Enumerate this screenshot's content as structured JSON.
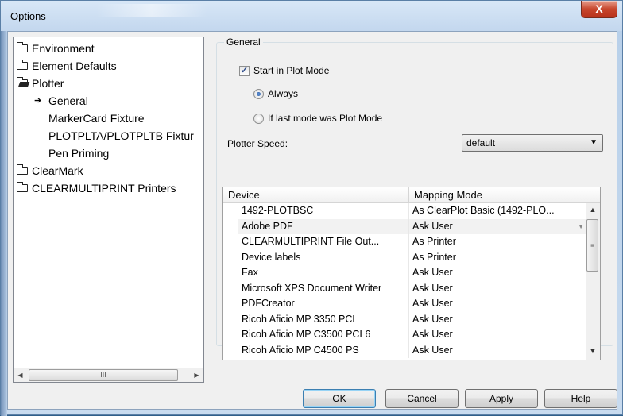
{
  "window": {
    "title": "Options",
    "close_glyph": "X"
  },
  "tree": {
    "items": [
      {
        "label": "Environment",
        "icon": "folder-icon",
        "level": 0
      },
      {
        "label": "Element Defaults",
        "icon": "folder-icon",
        "level": 0
      },
      {
        "label": "Plotter",
        "icon": "folder-open-icon",
        "level": 0
      },
      {
        "label": "General",
        "icon": "arrow-right-icon",
        "level": 1,
        "selected": true
      },
      {
        "label": "MarkerCard Fixture",
        "level": 1
      },
      {
        "label": "PLOTPLTA/PLOTPLTB Fixtur",
        "level": 1
      },
      {
        "label": "Pen Priming",
        "level": 1
      },
      {
        "label": "ClearMark",
        "icon": "folder-icon",
        "level": 0
      },
      {
        "label": "CLEARMULTIPRINT Printers",
        "icon": "folder-icon",
        "level": 0
      }
    ],
    "scroll_thumb_grip": "III"
  },
  "general": {
    "group_title": "General",
    "start_in_plot_mode": {
      "label": "Start in Plot Mode",
      "checked": true
    },
    "radio_always": {
      "label": "Always",
      "checked": true
    },
    "radio_last_mode": {
      "label": "If last mode was Plot Mode",
      "checked": false
    },
    "plotter_speed_label": "Plotter Speed:",
    "plotter_speed_value": "default"
  },
  "grid": {
    "columns": [
      "Device",
      "Mapping Mode"
    ],
    "rows": [
      {
        "device": "1492-PLOTBSC",
        "mapping": "As ClearPlot Basic (1492-PLO..."
      },
      {
        "device": "Adobe PDF",
        "mapping": "Ask User"
      },
      {
        "device": "CLEARMULTIPRINT File Out...",
        "mapping": "As Printer"
      },
      {
        "device": "Device labels",
        "mapping": "As Printer"
      },
      {
        "device": "Fax",
        "mapping": "Ask User"
      },
      {
        "device": "Microsoft XPS Document Writer",
        "mapping": "Ask User"
      },
      {
        "device": "PDFCreator",
        "mapping": "Ask User"
      },
      {
        "device": "Ricoh Aficio MP 3350 PCL",
        "mapping": "Ask User"
      },
      {
        "device": "Ricoh Aficio MP C3500 PCL6",
        "mapping": "Ask User"
      },
      {
        "device": "Ricoh Aficio MP C4500 PS",
        "mapping": "Ask User"
      }
    ]
  },
  "buttons": {
    "ok": "OK",
    "cancel": "Cancel",
    "apply": "Apply",
    "help": "Help"
  }
}
